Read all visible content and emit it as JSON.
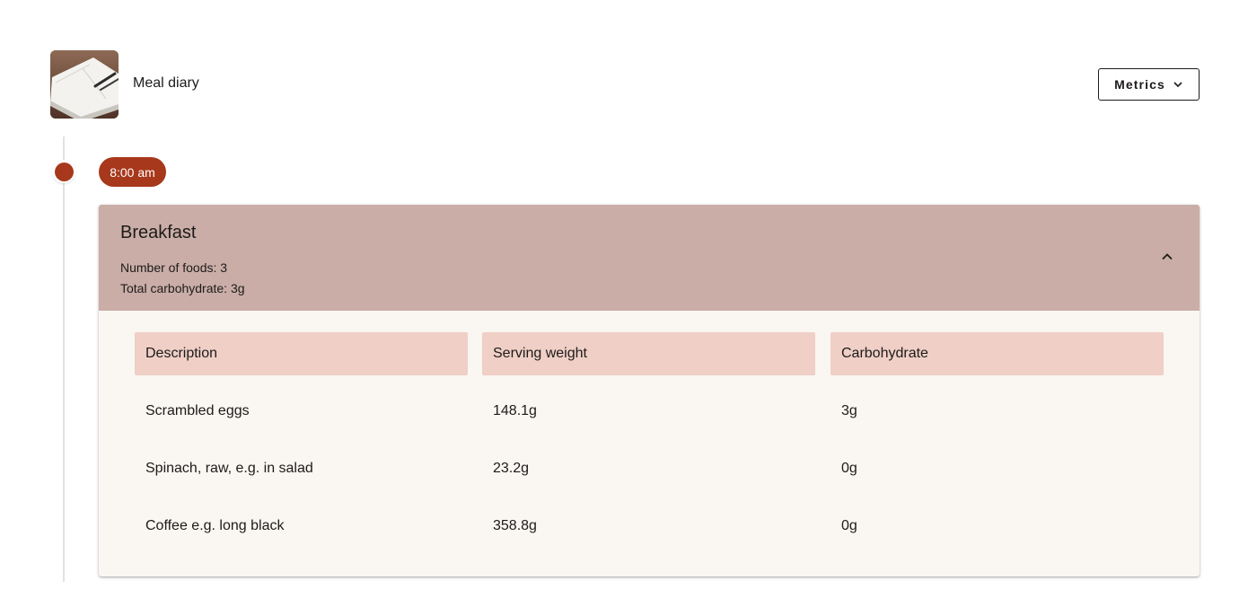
{
  "header": {
    "title": "Meal diary",
    "thumbnail_icon": "notebook-photo",
    "metrics_button": {
      "label": "Metrics",
      "icon": "chevron-down-icon"
    }
  },
  "timeline": {
    "accent_color": "#a7381c",
    "entries": [
      {
        "time": "8:00 am",
        "meal": {
          "name": "Breakfast",
          "num_foods_text": "Number of foods: 3",
          "total_carbs_text": "Total carbohydrate: 3g",
          "expanded": true,
          "toggle_icon": "chevron-up-icon",
          "table": {
            "columns": [
              "Description",
              "Serving weight",
              "Carbohydrate"
            ],
            "rows": [
              [
                "Scrambled eggs",
                "148.1g",
                "3g"
              ],
              [
                "Spinach, raw, e.g. in salad",
                "23.2g",
                "0g"
              ],
              [
                "Coffee e.g. long black",
                "358.8g",
                "0g"
              ]
            ]
          }
        }
      }
    ]
  },
  "colors": {
    "card_header_bg": "#caada7",
    "table_header_bg": "#efcfc6",
    "card_body_bg": "#faf6f2",
    "chip_bg": "#a7381c"
  }
}
